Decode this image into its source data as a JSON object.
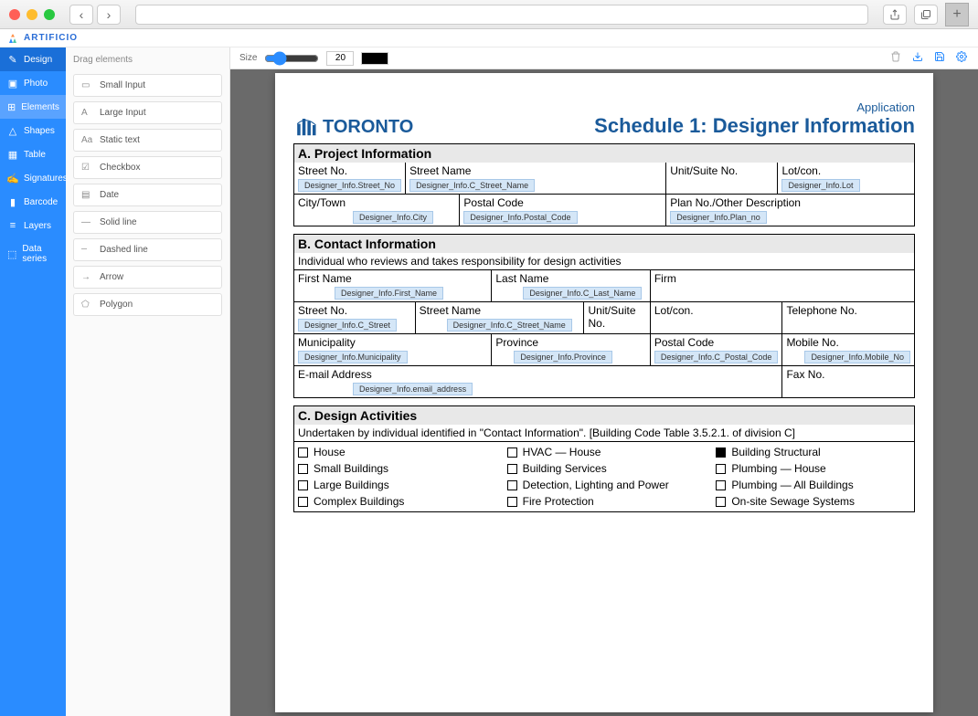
{
  "logo": "ARTIFICIO",
  "leftNav": {
    "design": "Design",
    "photo": "Photo",
    "elements": "Elements",
    "shapes": "Shapes",
    "table": "Table",
    "signatures": "Signatures",
    "barcode": "Barcode",
    "layers": "Layers",
    "dataSeries": "Data series"
  },
  "panel": {
    "title": "Drag elements",
    "items": {
      "smallInput": "Small Input",
      "largeInput": "Large Input",
      "static": "Static text",
      "checkbox": "Checkbox",
      "date": "Date",
      "solidLine": "Solid line",
      "dashedLine": "Dashed line",
      "arrow": "Arrow",
      "polygon": "Polygon"
    }
  },
  "toolbar": {
    "sizeLabel": "Size",
    "sizeValue": "20"
  },
  "doc": {
    "brand": "TORONTO",
    "appWord": "Application",
    "title": "Schedule 1: Designer Information",
    "secA": "A.  Project Information",
    "secB": "B.  Contact Information",
    "secBsub": "Individual who reviews and takes responsibility for design activities",
    "secC": "C.  Design Activities",
    "secCsub": "Undertaken by individual identified in \"Contact Information\". [Building Code Table 3.5.2.1. of division C]",
    "labels": {
      "streetNo": "Street No.",
      "streetName": "Street Name",
      "unit": "Unit/Suite No.",
      "lot": "Lot/con.",
      "cityTown": "City/Town",
      "postal": "Postal Code",
      "planNo": "Plan No./Other Description",
      "firstName": "First Name",
      "lastName": "Last Name",
      "firm": "Firm",
      "telephone": "Telephone No.",
      "municipality": "Municipality",
      "province": "Province",
      "mobile": "Mobile No.",
      "email": "E-mail Address",
      "fax": "Fax No."
    },
    "tags": {
      "streetNoA": "Designer_Info.Street_No",
      "streetNameA": "Designer_Info.C_Street_Name",
      "lotA": "Designer_Info.Lot",
      "cityA": "Designer_Info.City",
      "postalA": "Designer_Info.Postal_Code",
      "planA": "Designer_Info.Plan_no",
      "firstName": "Designer_Info.First_Name",
      "lastName": "Designer_Info.C_Last_Name",
      "streetNoB": "Designer_Info.C_Street",
      "streetNameB": "Designer_Info.C_Street_Name",
      "municipality": "Designer_Info.Municipality",
      "province": "Designer_Info.Province",
      "postalB": "Designer_Info.C_Postal_Code",
      "mobile": "Designer_Info.Mobile_No",
      "email": "Designer_Info.email_address"
    },
    "checkboxes": {
      "house": "House",
      "hvacHouse": "HVAC — House",
      "buildingStructural": "Building Structural",
      "smallBuildings": "Small Buildings",
      "buildingServices": "Building Services",
      "plumbingHouse": "Plumbing — House",
      "largeBuildings": "Large Buildings",
      "detection": "Detection, Lighting and Power",
      "plumbingAll": "Plumbing — All Buildings",
      "complex": "Complex Buildings",
      "fire": "Fire Protection",
      "sewage": "On-site Sewage Systems"
    }
  }
}
